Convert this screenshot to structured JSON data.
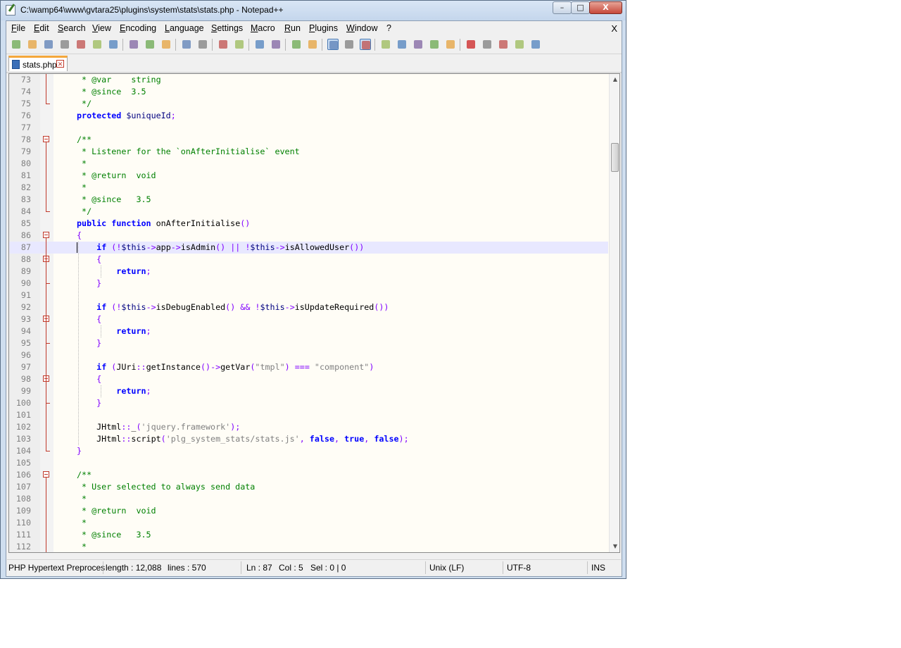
{
  "window": {
    "title": "C:\\wamp64\\www\\gvtara25\\plugins\\system\\stats\\stats.php - Notepad++",
    "controls": [
      "–",
      "□",
      "X"
    ]
  },
  "menu": {
    "items": [
      "File",
      "Edit",
      "Search",
      "View",
      "Encoding",
      "Language",
      "Settings",
      "Macro",
      "Run",
      "Plugins",
      "Window",
      "?"
    ],
    "close": "X"
  },
  "toolbar": {
    "icons": [
      "new-file-icon",
      "open-file-icon",
      "save-icon",
      "save-all-icon",
      "close-icon",
      "close-all-icon",
      "print-icon",
      "cut-icon",
      "copy-icon",
      "paste-icon",
      "undo-icon",
      "redo-icon",
      "find-icon",
      "replace-icon",
      "zoom-in-icon",
      "zoom-out-icon",
      "sync-vertical-icon",
      "sync-horizontal-icon",
      "word-wrap-icon",
      "show-all-chars-icon",
      "indent-guide-icon",
      "user-language-icon",
      "function-list-icon",
      "doc-map-icon",
      "folder-workspace-icon",
      "monitoring-icon",
      "record-macro-icon",
      "stop-record-icon",
      "play-macro-icon",
      "run-macro-multiple-icon",
      "save-macro-icon"
    ]
  },
  "tab": {
    "label": "stats.php"
  },
  "editor": {
    "lines": [
      {
        "n": "73",
        "t": "     * @var    string",
        "c": "cm"
      },
      {
        "n": "74",
        "t": "     * @since  3.5",
        "c": "cm"
      },
      {
        "n": "75",
        "t": "     */",
        "c": "cm"
      },
      {
        "n": "76",
        "t": "    protected $uniqueId;",
        "c": "mixed"
      },
      {
        "n": "77",
        "t": "",
        "c": "plain"
      },
      {
        "n": "78",
        "t": "    /**",
        "c": "cm"
      },
      {
        "n": "79",
        "t": "     * Listener for the `onAfterInitialise` event",
        "c": "cm"
      },
      {
        "n": "80",
        "t": "     *",
        "c": "cm"
      },
      {
        "n": "81",
        "t": "     * @return  void",
        "c": "cm"
      },
      {
        "n": "82",
        "t": "     *",
        "c": "cm"
      },
      {
        "n": "83",
        "t": "     * @since   3.5",
        "c": "cm"
      },
      {
        "n": "84",
        "t": "     */",
        "c": "cm"
      },
      {
        "n": "85",
        "t": "    public function onAfterInitialise()",
        "c": "mixed"
      },
      {
        "n": "86",
        "t": "    {",
        "c": "op"
      },
      {
        "n": "87",
        "t": "        if (!$this->app->isAdmin() || !$this->isAllowedUser())",
        "c": "mixed"
      },
      {
        "n": "88",
        "t": "        {",
        "c": "op"
      },
      {
        "n": "89",
        "t": "            return;",
        "c": "mixed"
      },
      {
        "n": "90",
        "t": "        }",
        "c": "op"
      },
      {
        "n": "91",
        "t": "",
        "c": "plain"
      },
      {
        "n": "92",
        "t": "        if (!$this->isDebugEnabled() && !$this->isUpdateRequired())",
        "c": "mixed"
      },
      {
        "n": "93",
        "t": "        {",
        "c": "op"
      },
      {
        "n": "94",
        "t": "            return;",
        "c": "mixed"
      },
      {
        "n": "95",
        "t": "        }",
        "c": "op"
      },
      {
        "n": "96",
        "t": "",
        "c": "plain"
      },
      {
        "n": "97",
        "t": "        if (JUri::getInstance()->getVar(\"tmpl\") === \"component\")",
        "c": "mixed"
      },
      {
        "n": "98",
        "t": "        {",
        "c": "op"
      },
      {
        "n": "99",
        "t": "            return;",
        "c": "mixed"
      },
      {
        "n": "100",
        "t": "        }",
        "c": "op"
      },
      {
        "n": "101",
        "t": "",
        "c": "plain"
      },
      {
        "n": "102",
        "t": "        JHtml::_('jquery.framework');",
        "c": "mixed"
      },
      {
        "n": "103",
        "t": "        JHtml::script('plg_system_stats/stats.js', false, true, false);",
        "c": "mixed"
      },
      {
        "n": "104",
        "t": "    }",
        "c": "op"
      },
      {
        "n": "105",
        "t": "",
        "c": "plain"
      },
      {
        "n": "106",
        "t": "    /**",
        "c": "cm"
      },
      {
        "n": "107",
        "t": "     * User selected to always send data",
        "c": "cm"
      },
      {
        "n": "108",
        "t": "     *",
        "c": "cm"
      },
      {
        "n": "109",
        "t": "     * @return  void",
        "c": "cm"
      },
      {
        "n": "110",
        "t": "     *",
        "c": "cm"
      },
      {
        "n": "111",
        "t": "     * @since   3.5",
        "c": "cm"
      },
      {
        "n": "112",
        "t": "     *",
        "c": "cm"
      }
    ],
    "current_line": "87",
    "fold_markers_at": [
      "78",
      "86",
      "88",
      "93",
      "98",
      "106"
    ]
  },
  "status": {
    "language": "PHP Hypertext Preproces",
    "length": "length : 12,088",
    "lines": "lines : 570",
    "ln": "Ln : 87",
    "col": "Col : 5",
    "sel": "Sel : 0 | 0",
    "eol": "Unix (LF)",
    "encoding": "UTF-8",
    "mode": "INS"
  },
  "colors": {
    "keyword": "#0000ff",
    "comment": "#008000",
    "variable": "#000080",
    "operator": "#8000ff",
    "string": "#808080",
    "current_line_bg": "#e8e8ff",
    "editor_bg": "#fffdf6"
  }
}
